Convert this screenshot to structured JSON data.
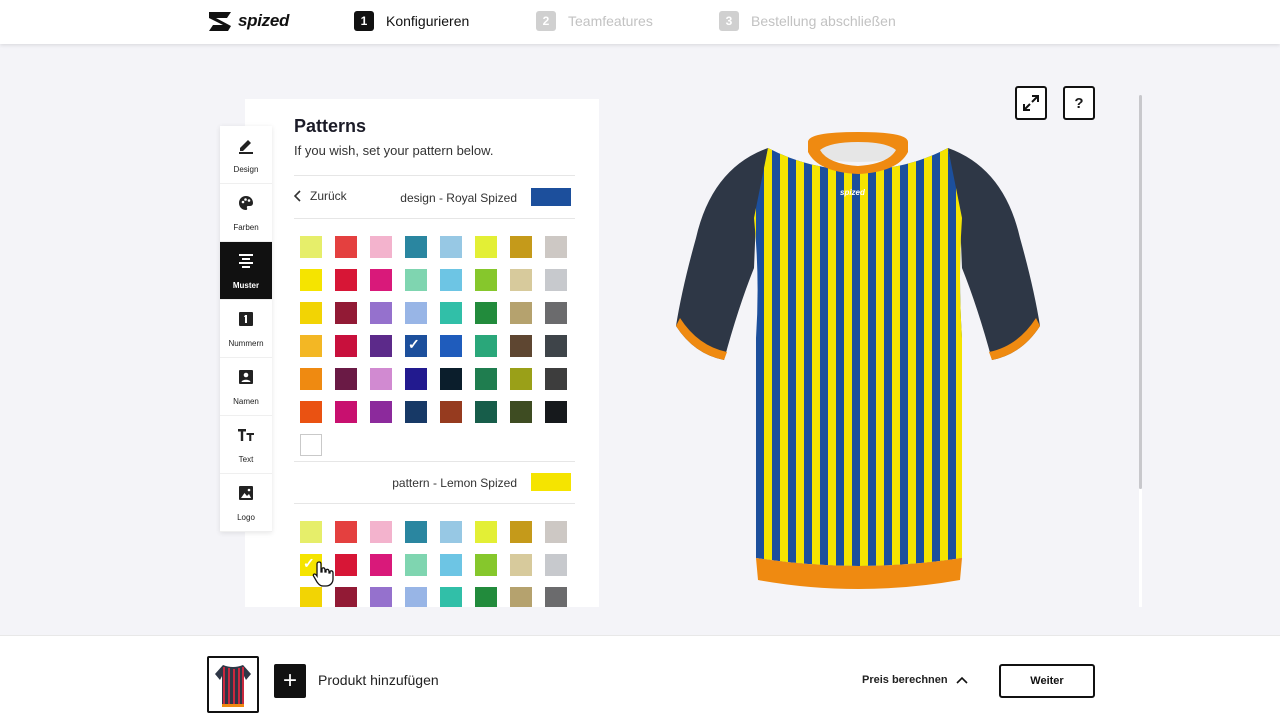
{
  "header": {
    "brand": "spized",
    "steps": [
      {
        "num": "1",
        "label": "Konfigurieren",
        "state": "active"
      },
      {
        "num": "2",
        "label": "Teamfeatures",
        "state": "inactive"
      },
      {
        "num": "3",
        "label": "Bestellung abschließen",
        "state": "inactive"
      }
    ]
  },
  "sidenav": {
    "items": [
      {
        "label": "Design",
        "icon": "pen-icon",
        "active": false
      },
      {
        "label": "Farben",
        "icon": "palette-icon",
        "active": false
      },
      {
        "label": "Muster",
        "icon": "pattern-icon",
        "active": true
      },
      {
        "label": "Nummern",
        "icon": "number-icon",
        "active": false
      },
      {
        "label": "Namen",
        "icon": "contact-icon",
        "active": false
      },
      {
        "label": "Text",
        "icon": "text-icon",
        "active": false
      },
      {
        "label": "Logo",
        "icon": "image-icon",
        "active": false
      }
    ]
  },
  "panel": {
    "title": "Patterns",
    "subtitle": "If you wish, set your pattern below.",
    "back_label": "Zurück",
    "design_section": {
      "label": "design - Royal Spized",
      "color": "#1c4f9c",
      "selected_index": 27
    },
    "pattern_section": {
      "label": "pattern - Lemon Spized",
      "color": "#f5e400",
      "selected_index": 8
    },
    "palette": [
      "#e6ee6a",
      "#e4403f",
      "#f3b3cd",
      "#2a86a0",
      "#97c8e4",
      "#e3ef35",
      "#c59a1a",
      "#cdc8c4",
      "#f5e400",
      "#d71636",
      "#d9197a",
      "#7fd5b0",
      "#6dc5e4",
      "#86c72c",
      "#d7ca9c",
      "#c7c9cd",
      "#f2d404",
      "#921a35",
      "#9571cd",
      "#98b5e6",
      "#31bfa8",
      "#228b3c",
      "#b5a26e",
      "#6b6b6d",
      "#f3b724",
      "#c8103c",
      "#5c2a8a",
      "#1c4f9c",
      "#1f5cbc",
      "#2aa77a",
      "#5e4631",
      "#3e4449",
      "#ef8a11",
      "#6a1a45",
      "#d18ad1",
      "#221a8f",
      "#0b1e2c",
      "#1f7d4f",
      "#9aa018",
      "#3d3d3d",
      "#ea5212",
      "#c8106f",
      "#8c2a9c",
      "#173966",
      "#963b1f",
      "#175d4a",
      "#3e4c22",
      "#16191c",
      "#ffffff"
    ]
  },
  "product": {
    "fullscreen_icon": "expand-icon",
    "help_label": "?",
    "body_stripe_a": "#1c4f9c",
    "body_stripe_b": "#f5e400",
    "sleeve_color": "#2e3746",
    "trim_color": "#ef8a11",
    "shirt_logo": "spized"
  },
  "footer": {
    "add_product_label": "Produkt hinzufügen",
    "price_label": "Preis berechnen",
    "next_label": "Weiter"
  }
}
